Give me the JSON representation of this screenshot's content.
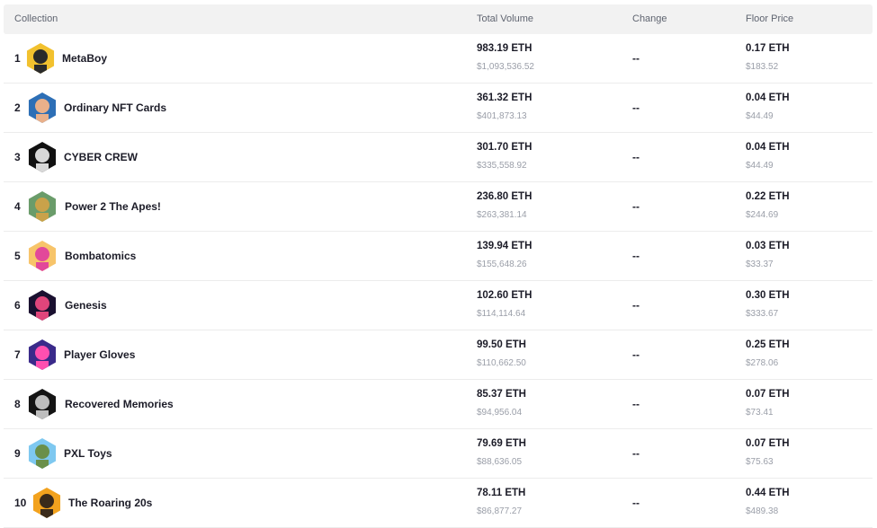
{
  "table": {
    "headers": {
      "collection": "Collection",
      "total_volume": "Total Volume",
      "change": "Change",
      "floor_price": "Floor Price"
    },
    "rows": [
      {
        "rank": "1",
        "name": "MetaBoy",
        "volume_eth": "983.19 ETH",
        "volume_usd": "$1,093,536.52",
        "change": "--",
        "floor_eth": "0.17 ETH",
        "floor_usd": "$183.52",
        "avatar_colors": [
          "#f2c12e",
          "#2a2a2a"
        ]
      },
      {
        "rank": "2",
        "name": "Ordinary NFT Cards",
        "volume_eth": "361.32 ETH",
        "volume_usd": "$401,873.13",
        "change": "--",
        "floor_eth": "0.04 ETH",
        "floor_usd": "$44.49",
        "avatar_colors": [
          "#2d6fb6",
          "#e9b08a"
        ]
      },
      {
        "rank": "3",
        "name": "CYBER CREW",
        "volume_eth": "301.70 ETH",
        "volume_usd": "$335,558.92",
        "change": "--",
        "floor_eth": "0.04 ETH",
        "floor_usd": "$44.49",
        "avatar_colors": [
          "#111111",
          "#d8d8d8"
        ]
      },
      {
        "rank": "4",
        "name": "Power 2 The Apes!",
        "volume_eth": "236.80 ETH",
        "volume_usd": "$263,381.14",
        "change": "--",
        "floor_eth": "0.22 ETH",
        "floor_usd": "$244.69",
        "avatar_colors": [
          "#6a9c6a",
          "#c9a24a"
        ]
      },
      {
        "rank": "5",
        "name": "Bombatomics",
        "volume_eth": "139.94 ETH",
        "volume_usd": "$155,648.26",
        "change": "--",
        "floor_eth": "0.03 ETH",
        "floor_usd": "$33.37",
        "avatar_colors": [
          "#f7c46a",
          "#e2489a"
        ]
      },
      {
        "rank": "6",
        "name": "Genesis",
        "volume_eth": "102.60 ETH",
        "volume_usd": "$114,114.64",
        "change": "--",
        "floor_eth": "0.30 ETH",
        "floor_usd": "$333.67",
        "avatar_colors": [
          "#1a1030",
          "#e0457b"
        ]
      },
      {
        "rank": "7",
        "name": "Player Gloves",
        "volume_eth": "99.50 ETH",
        "volume_usd": "$110,662.50",
        "change": "--",
        "floor_eth": "0.25 ETH",
        "floor_usd": "$278.06",
        "avatar_colors": [
          "#3a2a8a",
          "#ff4fb0"
        ]
      },
      {
        "rank": "8",
        "name": "Recovered Memories",
        "volume_eth": "85.37 ETH",
        "volume_usd": "$94,956.04",
        "change": "--",
        "floor_eth": "0.07 ETH",
        "floor_usd": "$73.41",
        "avatar_colors": [
          "#141414",
          "#bdbdbd"
        ]
      },
      {
        "rank": "9",
        "name": "PXL Toys",
        "volume_eth": "79.69 ETH",
        "volume_usd": "$88,636.05",
        "change": "--",
        "floor_eth": "0.07 ETH",
        "floor_usd": "$75.63",
        "avatar_colors": [
          "#7ec8f0",
          "#6a8f4a"
        ]
      },
      {
        "rank": "10",
        "name": "The Roaring 20s",
        "volume_eth": "78.11 ETH",
        "volume_usd": "$86,877.27",
        "change": "--",
        "floor_eth": "0.44 ETH",
        "floor_usd": "$489.38",
        "avatar_colors": [
          "#f2a21e",
          "#3a2a1a"
        ]
      }
    ]
  }
}
